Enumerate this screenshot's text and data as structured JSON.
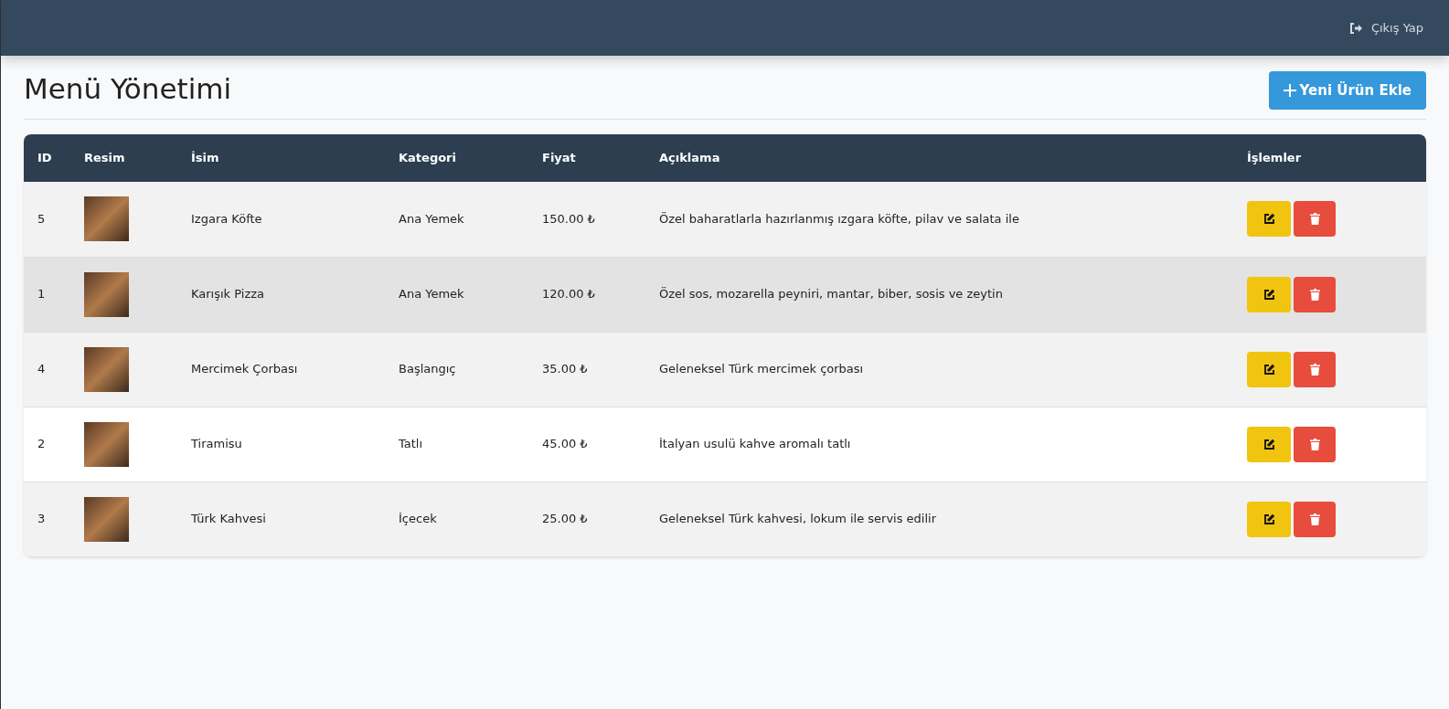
{
  "navbar": {
    "logout_label": "Çıkış Yap"
  },
  "page": {
    "title": "Menü Yönetimi",
    "add_button": "Yeni Ürün Ekle"
  },
  "table": {
    "columns": [
      "ID",
      "Resim",
      "İsim",
      "Kategori",
      "Fiyat",
      "Açıklama",
      "İşlemler"
    ],
    "rows": [
      {
        "id": "5",
        "name": "Izgara Köfte",
        "category": "Ana Yemek",
        "price": "150.00 ₺",
        "description": "Özel baharatlarla hazırlanmış ızgara köfte, pilav ve salata ile",
        "highlighted": false
      },
      {
        "id": "1",
        "name": "Karışık Pizza",
        "category": "Ana Yemek",
        "price": "120.00 ₺",
        "description": "Özel sos, mozarella peyniri, mantar, biber, sosis ve zeytin",
        "highlighted": true
      },
      {
        "id": "4",
        "name": "Mercimek Çorbası",
        "category": "Başlangıç",
        "price": "35.00 ₺",
        "description": "Geleneksel Türk mercimek çorbası",
        "highlighted": false
      },
      {
        "id": "2",
        "name": "Tiramisu",
        "category": "Tatlı",
        "price": "45.00 ₺",
        "description": "İtalyan usulü kahve aromalı tatlı",
        "highlighted": false
      },
      {
        "id": "3",
        "name": "Türk Kahvesi",
        "category": "İçecek",
        "price": "25.00 ₺",
        "description": "Geleneksel Türk kahvesi, lokum ile servis edilir",
        "highlighted": false
      }
    ]
  }
}
